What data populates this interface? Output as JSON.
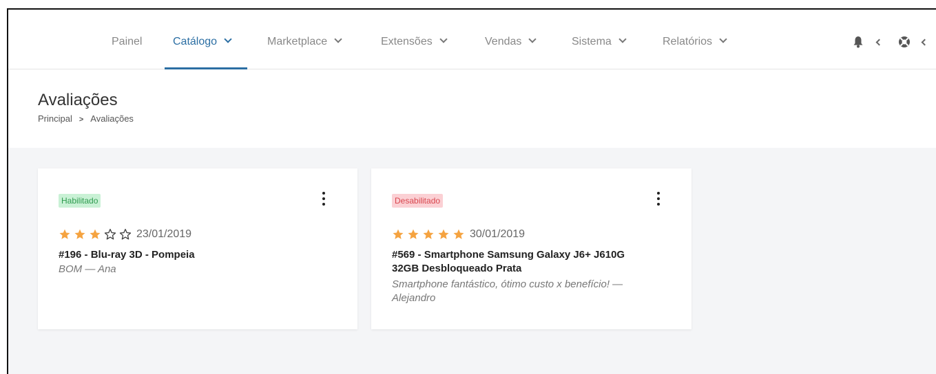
{
  "nav": {
    "items": [
      {
        "label": "Painel",
        "active": false,
        "dropdown": false
      },
      {
        "label": "Catálogo",
        "active": true,
        "dropdown": true
      },
      {
        "label": "Marketplace",
        "active": false,
        "dropdown": true
      },
      {
        "label": "Extensões",
        "active": false,
        "dropdown": true
      },
      {
        "label": "Vendas",
        "active": false,
        "dropdown": true
      },
      {
        "label": "Sistema",
        "active": false,
        "dropdown": true
      },
      {
        "label": "Relatórios",
        "active": false,
        "dropdown": true
      }
    ],
    "icons": [
      "bell-icon",
      "lifebuoy-icon"
    ],
    "accent": "#2b6ea3"
  },
  "header": {
    "title": "Avaliações",
    "breadcrumb": [
      "Principal",
      "Avaliações"
    ]
  },
  "reviews": [
    {
      "status": "Habilitado",
      "status_color": "#2e9b4f",
      "rating": 3,
      "max_rating": 5,
      "date": "23/01/2019",
      "product_line1": "#196 - Blu-ray 3D - Pompeia",
      "product_line2": "",
      "review_line1": "BOM — Ana",
      "review_line2": ""
    },
    {
      "status": "Desabilitado",
      "status_color": "#d9474f",
      "rating": 5,
      "max_rating": 5,
      "date": "30/01/2019",
      "product_line1": "#569 - Smartphone Samsung Galaxy J6+ J610G",
      "product_line2": "32GB Desbloqueado Prata",
      "review_line1": "Smartphone fantástico, ótimo custo x benefício! —",
      "review_line2": "Alejandro"
    }
  ],
  "star_color": "#f5a340"
}
